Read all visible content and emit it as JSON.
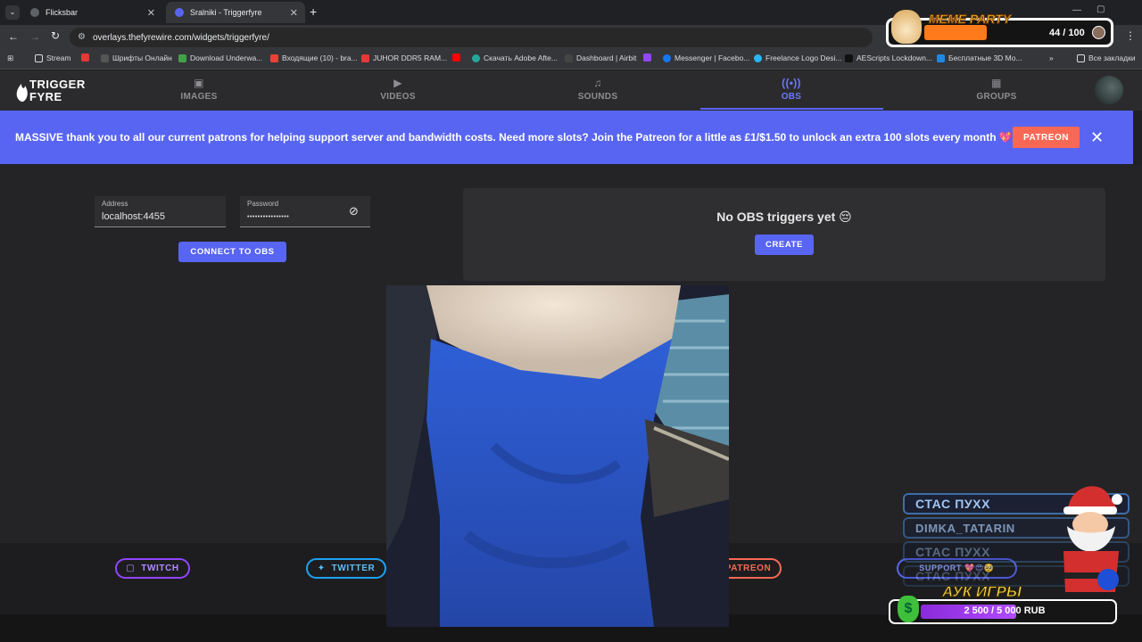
{
  "browser": {
    "tabs": [
      {
        "label": "Flicksbar"
      },
      {
        "label": "Sralniki - Triggerfyre"
      }
    ],
    "url": "overlays.thefyrewire.com/widgets/triggerfyre/",
    "bookmarks": [
      {
        "label": "Stream"
      },
      {
        "label": "Шрифты Онлайн"
      },
      {
        "label": "Download Underwa..."
      },
      {
        "label": "Входящие (10) - bra..."
      },
      {
        "label": "JUHOR DDR5 RAM..."
      },
      {
        "label": "Скачать Adobe Afte..."
      },
      {
        "label": "Dashboard | Airbit"
      },
      {
        "label": "Messenger | Facebo..."
      },
      {
        "label": "Freelance Logo Desi..."
      },
      {
        "label": "AEScripts Lockdown..."
      },
      {
        "label": "Бесплатные 3D Mo..."
      }
    ],
    "all_bookmarks": "Все закладки"
  },
  "site": {
    "logo": "TRIGGER FYRE",
    "nav": [
      {
        "label": "IMAGES",
        "icon": "image-icon"
      },
      {
        "label": "VIDEOS",
        "icon": "video-icon"
      },
      {
        "label": "SOUNDS",
        "icon": "music-icon"
      },
      {
        "label": "OBS",
        "icon": "broadcast-icon",
        "active": true
      },
      {
        "label": "GROUPS",
        "icon": "groups-icon"
      }
    ]
  },
  "banner": {
    "text": "MASSIVE thank you to all our current patrons for helping support server and bandwidth costs. Need more slots? Join the Patreon for a little as £1/$1.50 to unlock an extra 100 slots every month 💖",
    "button": "PATREON"
  },
  "obs": {
    "address_label": "Address",
    "address_value": "localhost:4455",
    "password_label": "Password",
    "password_value": "••••••••••••••••",
    "connect_button": "CONNECT TO OBS",
    "empty_title": "No OBS triggers yet 😔",
    "create_button": "CREATE"
  },
  "footer": {
    "twitch": "TWITCH",
    "twitter": "TWITTER",
    "patreon": "PATREON",
    "support": "SUPPORT 💖😍🥺"
  },
  "overlay": {
    "meme_title": "MEME PARTY",
    "meme_count": "44 / 100",
    "meme_progress": 0.44,
    "donors": [
      "СТАС ПУХХ",
      "DIMKA_TATARIN",
      "СТАС ПУХХ",
      "СТАС ПУХХ"
    ],
    "auction_title": "АУК ИГРЫ",
    "auction_count": "2 500 / 5 000 RUB",
    "auction_progress": 0.5
  },
  "colors": {
    "accent": "#5865f2",
    "patreon": "#f96854",
    "twitch": "#9146ff",
    "twitter": "#1da1f2"
  }
}
